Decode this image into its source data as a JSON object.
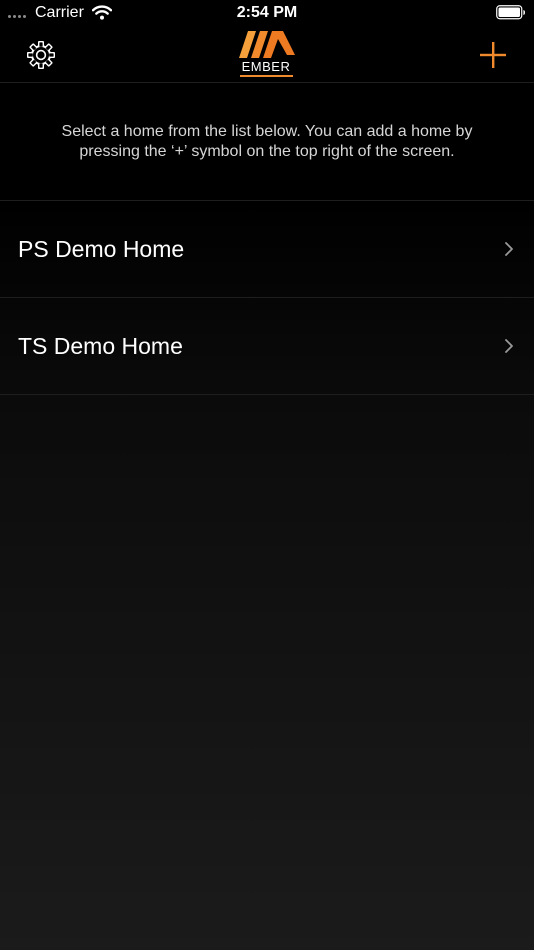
{
  "status_bar": {
    "carrier": "Carrier",
    "time": "2:54 PM",
    "wifi_icon": "wifi-icon",
    "battery_icon": "battery-icon"
  },
  "nav": {
    "settings_icon": "gear-icon",
    "logo_text": "EMBER",
    "add_icon": "plus-icon",
    "accent_color": "#f08a2c"
  },
  "instructions": "Select a home from the list below.  You can add a home by pressing the ‘+’ symbol on the top right of the screen.",
  "homes": [
    {
      "name": "PS Demo Home"
    },
    {
      "name": "TS Demo Home"
    }
  ]
}
